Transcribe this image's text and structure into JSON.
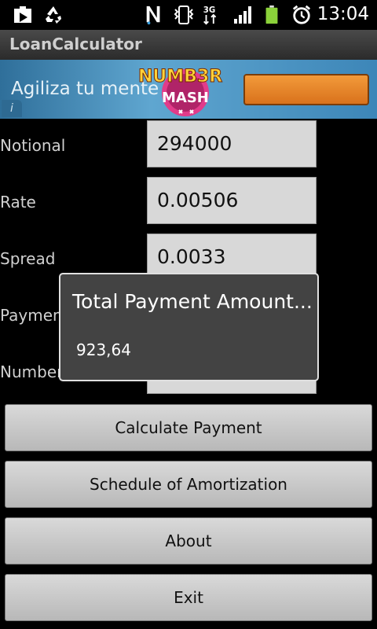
{
  "status_bar": {
    "time": "13:04",
    "icons": [
      "download-icon",
      "recycle-icon",
      "nfc-icon",
      "vibrate-icon",
      "3g-icon",
      "signal-icon",
      "battery-icon",
      "alarm-icon"
    ]
  },
  "app": {
    "title": "LoanCalculator"
  },
  "ad": {
    "text": "Agiliza tu mente",
    "logo_text": "NUMB3R MASH",
    "info": "i"
  },
  "form": {
    "notional": {
      "label": "Notional",
      "value": "294000"
    },
    "rate": {
      "label": "Rate",
      "value": "0.00506"
    },
    "spread": {
      "label": "Spread",
      "value": "0.0033"
    },
    "payment": {
      "label": "Paymen",
      "value": ""
    },
    "number": {
      "label": "Number",
      "value": ""
    }
  },
  "buttons": {
    "calculate": "Calculate Payment",
    "schedule": "Schedule of Amortization",
    "about": "About",
    "exit": "Exit"
  },
  "dialog": {
    "title": "Total Payment Amount...",
    "message": "923,64"
  },
  "colors": {
    "battery": "#8bd23a",
    "ad_button": "#e8842a",
    "dialog_bg": "#434343"
  }
}
